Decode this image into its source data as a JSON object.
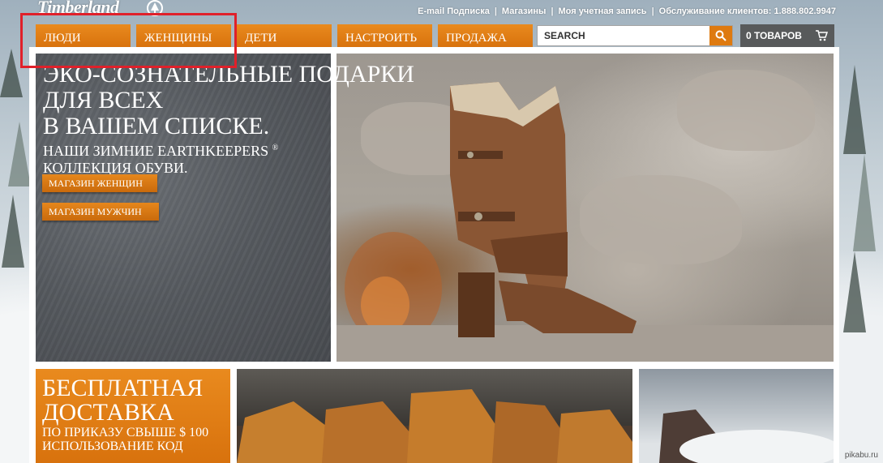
{
  "brand": {
    "logo": "Timberland"
  },
  "toplinks": [
    "E-mail Подписка",
    "Магазины",
    "Моя учетная запись",
    "Обслуживание клиентов: 1.888.802.9947"
  ],
  "nav": [
    "ЛЮДИ",
    "ЖЕНЩИНЫ",
    "ДЕТИ",
    "НАСТРОИТЬ",
    "ПРОДАЖА"
  ],
  "search": {
    "value": "SEARCH",
    "icon": "search-icon"
  },
  "cart": {
    "label": "0 ТОВАРОВ",
    "icon": "cart-icon"
  },
  "hero": {
    "title_lines": [
      "ЭКО-СОЗНАТЕЛЬНЫЕ ПОДАРКИ",
      "ДЛЯ ВСЕХ",
      "В ВАШЕМ СПИСКЕ."
    ],
    "subtitle_line1": "НАШИ ЗИМНИЕ EARTHKEEPERS",
    "subtitle_reg": "®",
    "subtitle_line2": "КОЛЛЕКЦИЯ ОБУВИ.",
    "btn_women": "МАГАЗИН ЖЕНЩИН",
    "btn_men": "МАГАЗИН МУЖЧИН"
  },
  "promo": {
    "title_lines": [
      "БЕСПЛАТНАЯ",
      "ДОСТАВКА"
    ],
    "text": "ПО ПРИКАЗУ СВЫШЕ $ 100 ИСПОЛЬЗОВАНИЕ КОД"
  },
  "watermark": "pikabu.ru",
  "colors": {
    "accent": "#de7a10",
    "highlight": "#e0202a",
    "cart_bg": "#585a5b"
  }
}
